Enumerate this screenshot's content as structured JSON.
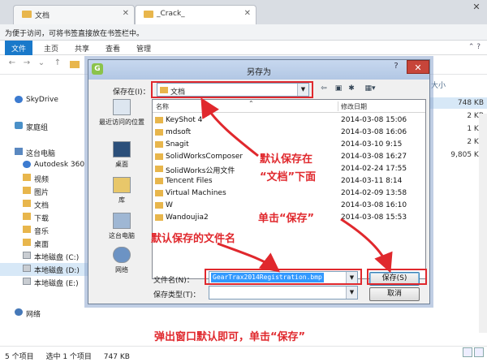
{
  "explorer": {
    "tabs": [
      {
        "label": "文档"
      },
      {
        "label": "_Crack_"
      }
    ],
    "close_glyph": "✕",
    "bookmark_hint": "为便于访问，可将书签直接放在书签栏中。",
    "ribbon_tabs": [
      {
        "label": "文件",
        "active": true
      },
      {
        "label": "主页"
      },
      {
        "label": "共享"
      },
      {
        "label": "查看"
      },
      {
        "label": "管理"
      }
    ],
    "size_header": "大小",
    "sizes": [
      "748 KB",
      "2 KB",
      "1 KB",
      "2 KB",
      "9,805 KB"
    ],
    "nav": {
      "skydrive": "SkyDrive",
      "homegroup": "家庭组",
      "this_pc": "这台电脑",
      "items": [
        "Autodesk 360",
        "视频",
        "图片",
        "文档",
        "下载",
        "音乐",
        "桌面",
        "本地磁盘 (C:)",
        "本地磁盘 (D:)",
        "本地磁盘 (E:)"
      ],
      "network": "网络"
    },
    "status": {
      "count": "5 个项目",
      "selected": "选中 1 个项目",
      "size": "747 KB"
    }
  },
  "dialog": {
    "title": "另存为",
    "logo": "G",
    "help_glyph": "?",
    "close_glyph": "✕",
    "save_in_label": "保存在(I)：",
    "save_in_value": "文档",
    "places": [
      "最近访问的位置",
      "桌面",
      "库",
      "这台电脑",
      "网络"
    ],
    "columns": {
      "name": "名称",
      "date": "修改日期"
    },
    "files": [
      {
        "name": "KeyShot 4",
        "date": "2014-03-08 15:06"
      },
      {
        "name": "mdsoft",
        "date": "2014-03-08 16:06"
      },
      {
        "name": "Snagit",
        "date": "2014-03-10 9:15"
      },
      {
        "name": "SolidWorksComposer",
        "date": "2014-03-08 16:27"
      },
      {
        "name": "SolidWorks公用文件",
        "date": "2014-02-24 17:55"
      },
      {
        "name": "Tencent Files",
        "date": "2014-03-11 8:14"
      },
      {
        "name": "Virtual Machines",
        "date": "2014-02-09 13:58"
      },
      {
        "name": "W",
        "date": "2014-03-08 16:10"
      },
      {
        "name": "Wandoujia2",
        "date": "2014-03-08 15:53"
      }
    ],
    "filename_label": "文件名(N)：",
    "filename_value": "GearTrax2014Registration.bmp",
    "filetype_label": "保存类型(T)：",
    "save_button": "保存(S)",
    "cancel_button": "取消",
    "dropdown_glyph": "▼"
  },
  "annotations": {
    "save_location_line1": "默认保存在",
    "save_location_line2": "“文档”下面",
    "click_save": "单击“保存”",
    "default_filename": "默认保存的文件名",
    "bottom_note": "弹出窗口默认即可，单击“保存”",
    "color": "#e0282d"
  }
}
